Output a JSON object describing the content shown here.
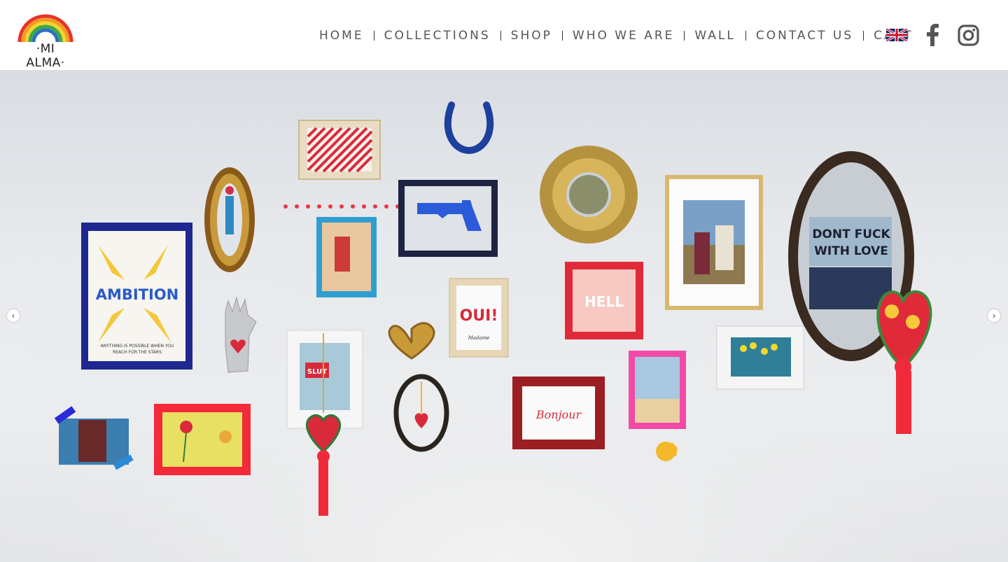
{
  "header": {
    "logo_text": "·MI ALMA·",
    "nav": [
      {
        "label": "HOME"
      },
      {
        "label": "COLLECTIONS"
      },
      {
        "label": "SHOP"
      },
      {
        "label": "WHO WE ARE"
      },
      {
        "label": "WALL"
      },
      {
        "label": "CONTACT US"
      },
      {
        "label": "CART"
      }
    ],
    "icons": {
      "language": "uk-flag-icon",
      "facebook": "facebook-icon",
      "instagram": "instagram-icon"
    }
  },
  "hero": {
    "prev_arrow": "‹",
    "next_arrow": "›",
    "artwork_text": {
      "ambition": "AMBITION",
      "ambition_sub1": "ANYTHING IS POSSIBLE WHEN YOU",
      "ambition_sub2": "REACH FOR THE STARS",
      "oui": "OUI!",
      "oui_sub": "Madame",
      "hell": "HELL",
      "bonjour": "Bonjour",
      "slut": "SLUT",
      "mirror_line1": "DONT FUCK",
      "mirror_line2": "WITH LOVE"
    }
  },
  "colors": {
    "nav_text": "#555555",
    "wall": "#e7e9ec"
  }
}
